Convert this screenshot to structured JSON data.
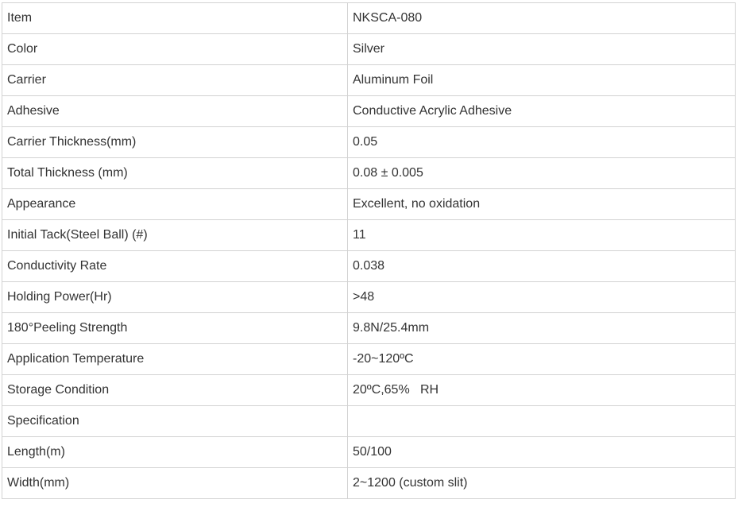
{
  "table": {
    "rows": [
      {
        "label": "Item",
        "value": "NKSCA-080"
      },
      {
        "label": "Color",
        "value": "Silver"
      },
      {
        "label": "Carrier",
        "value": "Aluminum Foil"
      },
      {
        "label": "Adhesive",
        "value": "Conductive Acrylic Adhesive"
      },
      {
        "label": "Carrier Thickness(mm)",
        "value": "0.05"
      },
      {
        "label": "Total Thickness (mm)",
        "value": "0.08 ± 0.005"
      },
      {
        "label": "Appearance",
        "value": "Excellent, no oxidation"
      },
      {
        "label": "Initial Tack(Steel Ball) (#)",
        "value": "11"
      },
      {
        "label": "Conductivity Rate",
        "value": "0.038"
      },
      {
        "label": "Holding Power(Hr)",
        "value": ">48"
      },
      {
        "label": "180°Peeling Strength",
        "value": "9.8N/25.4mm"
      },
      {
        "label": "Application Temperature",
        "value": "-20~120ºC"
      },
      {
        "label": "Storage Condition",
        "value": "20ºC,65%   RH"
      },
      {
        "label": "Specification",
        "value": ""
      },
      {
        "label": "Length(m)",
        "value": "50/100"
      },
      {
        "label": "Width(mm)",
        "value": "2~1200 (custom slit)"
      }
    ]
  }
}
